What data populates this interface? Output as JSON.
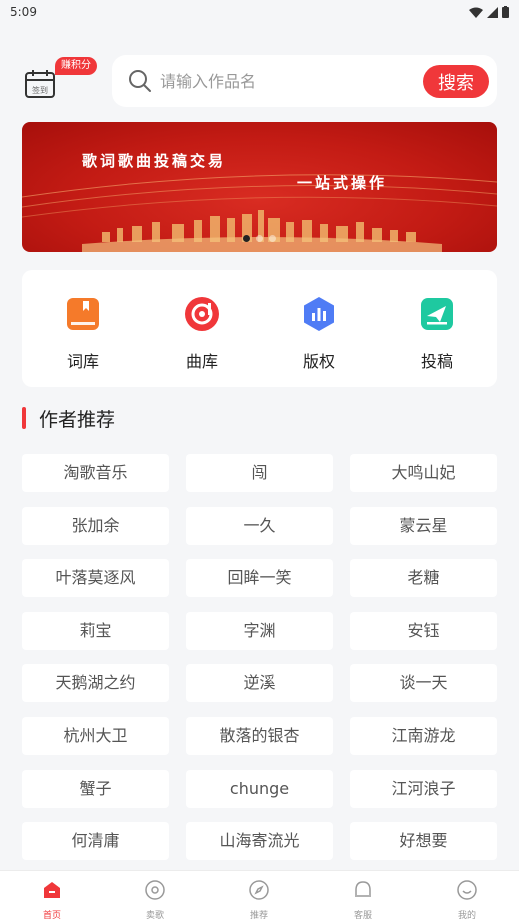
{
  "status_bar": {
    "time": "5:09"
  },
  "header": {
    "earn_badge": "赚积分",
    "checkin_label": "签到",
    "search_placeholder": "请输入作品名",
    "search_button": "搜索"
  },
  "banner": {
    "line1": "歌词歌曲投稿交易",
    "line2": "一站式操作",
    "page_count": 3,
    "active_page": 1
  },
  "quick_nav": [
    {
      "label": "词库",
      "icon": "book-icon",
      "color": "#f57a2a"
    },
    {
      "label": "曲库",
      "icon": "music-disc-icon",
      "color": "#f0373a"
    },
    {
      "label": "版权",
      "icon": "copyright-chart-icon",
      "color": "#4f7cf5"
    },
    {
      "label": "投稿",
      "icon": "submit-paper-plane-icon",
      "color": "#1ec9a0"
    }
  ],
  "section": {
    "title": "作者推荐"
  },
  "authors": [
    "淘歌音乐",
    "闯",
    "大鸣山妃",
    "张加余",
    "一久",
    "蒙云星",
    "叶落莫逐风",
    "回眸一笑",
    "老糖",
    "莉宝",
    "字渊",
    "安钰",
    "天鹅湖之约",
    "逆溪",
    "谈一天",
    "杭州大卫",
    "散落的银杏",
    "江南游龙",
    "蟹子",
    "chunge",
    "江河浪子",
    "何清庸",
    "山海寄流光",
    "好想要"
  ],
  "tabs": [
    {
      "label": "首页",
      "icon": "home-icon",
      "active": true
    },
    {
      "label": "卖歌",
      "icon": "disc-icon",
      "active": false
    },
    {
      "label": "推荐",
      "icon": "compass-icon",
      "active": false
    },
    {
      "label": "客服",
      "icon": "headset-icon",
      "active": false
    },
    {
      "label": "我的",
      "icon": "smile-icon",
      "active": false
    }
  ],
  "colors": {
    "accent": "#f0373a",
    "background": "#f5f6f8"
  }
}
